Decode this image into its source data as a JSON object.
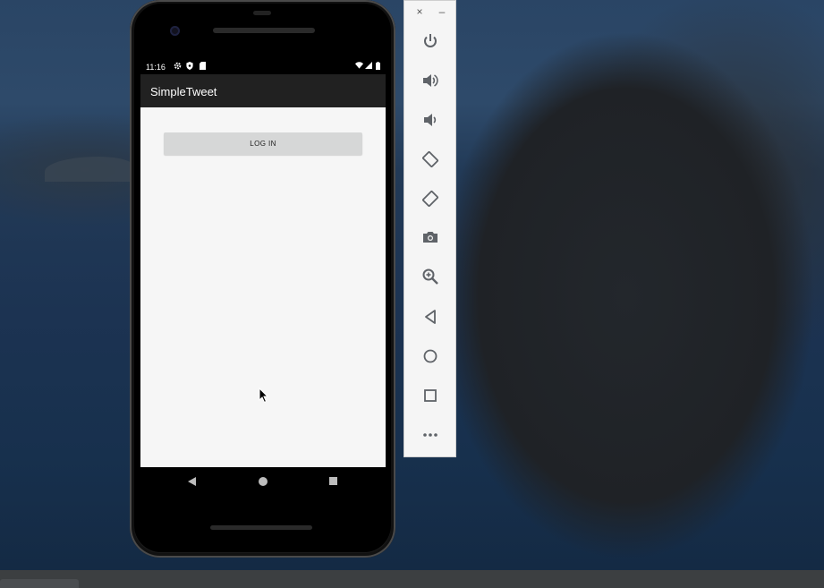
{
  "app": {
    "title": "SimpleTweet",
    "login_label": "LOG IN"
  },
  "statusbar": {
    "time": "11:16"
  },
  "icons": {
    "status_left": [
      "gear-icon",
      "shield-icon",
      "sd-card-icon"
    ],
    "status_right": [
      "wifi-icon",
      "signal-icon",
      "battery-icon"
    ],
    "nav": [
      "back-icon",
      "home-icon",
      "recents-icon"
    ],
    "toolbar": [
      "power-icon",
      "volume-up-icon",
      "volume-down-icon",
      "rotate-left-icon",
      "rotate-right-icon",
      "camera-icon",
      "zoom-icon",
      "back-icon",
      "home-icon",
      "overview-icon",
      "more-icon"
    ]
  },
  "toolbar_window": {
    "close_glyph": "×",
    "minimize_glyph": "–"
  },
  "colors": {
    "appbar": "#212121",
    "content_bg": "#f6f6f6",
    "button_bg": "#d6d7d7",
    "toolbar_icon": "#5f6368"
  }
}
